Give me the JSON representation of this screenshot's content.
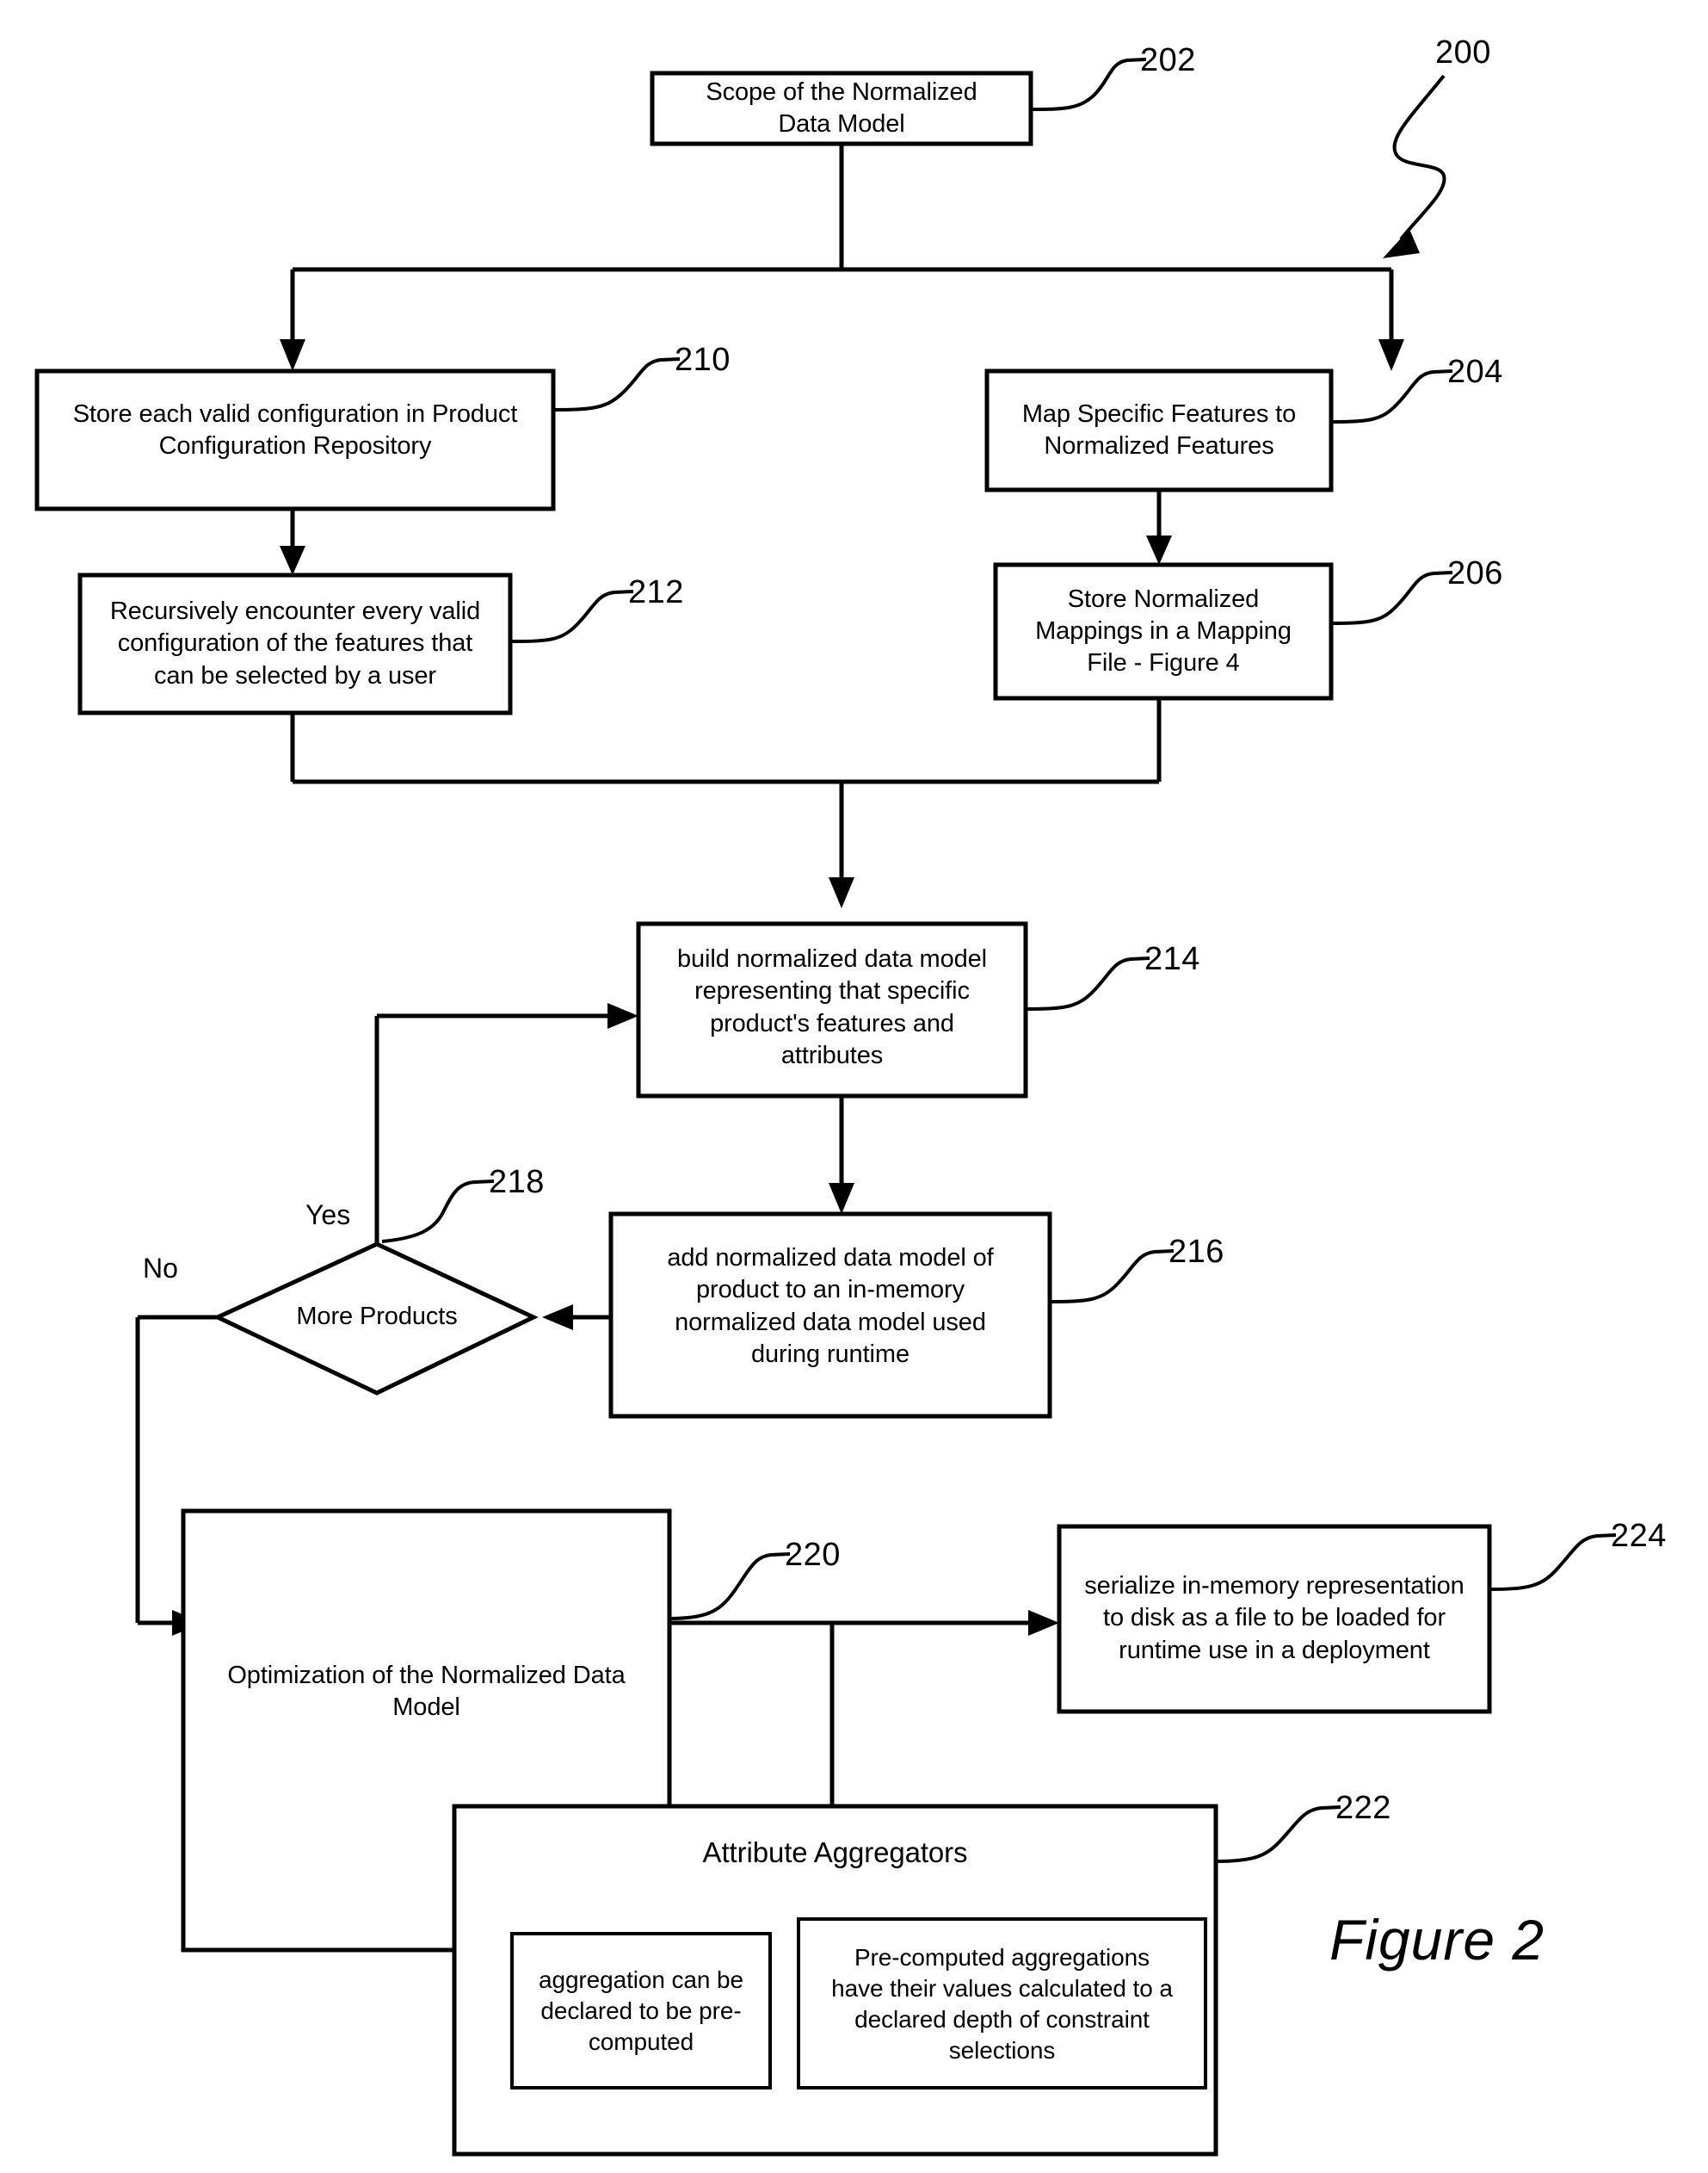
{
  "figure": {
    "caption": "Figure 2",
    "diagram_ref": "200"
  },
  "nodes": [
    {
      "id": "scope",
      "ref": "202",
      "text": "Scope of the Normalized\nData Model"
    },
    {
      "id": "store-config",
      "ref": "210",
      "text": "Store each valid configuration in Product\nConfiguration Repository"
    },
    {
      "id": "map-features",
      "ref": "204",
      "text": "Map Specific Features to\nNormalized Features"
    },
    {
      "id": "recursive",
      "ref": "212",
      "text": "Recursively encounter every valid\nconfiguration of the features that\ncan be selected by a user"
    },
    {
      "id": "store-mappings",
      "ref": "206",
      "text": "Store Normalized\nMappings in a Mapping\nFile - Figure 4"
    },
    {
      "id": "build-model",
      "ref": "214",
      "text": "build normalized data model\nrepresenting that specific\nproduct's features and\nattributes"
    },
    {
      "id": "add-model",
      "ref": "216",
      "text": "add normalized data model of\nproduct to an in-memory\nnormalized data model used\nduring runtime"
    },
    {
      "id": "more-products",
      "ref": "218",
      "text": "More Products"
    },
    {
      "id": "optimization",
      "ref": "220",
      "text": "Optimization of the Normalized Data\nModel"
    },
    {
      "id": "serialize",
      "ref": "224",
      "text": "serialize in-memory representation\nto disk as a file to be loaded for\nruntime use in a deployment"
    },
    {
      "id": "attribute-aggregators",
      "ref": "222",
      "text": "Attribute Aggregators"
    },
    {
      "id": "agg-precomputed",
      "ref": "",
      "text": "aggregation can be\ndeclared to be pre-\ncomputed"
    },
    {
      "id": "agg-values",
      "ref": "",
      "text": "Pre-computed aggregations\nhave their values calculated to a\ndeclared depth of constraint\nselections"
    }
  ],
  "edge_labels": {
    "yes": "Yes",
    "no": "No"
  }
}
